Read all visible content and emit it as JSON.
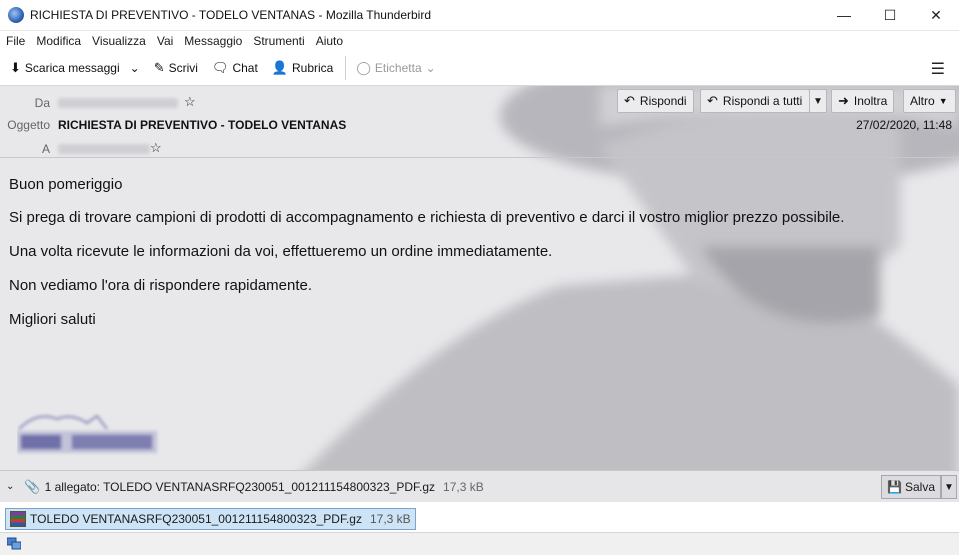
{
  "window": {
    "title": "RICHIESTA DI PREVENTIVO - TODELO VENTANAS - Mozilla Thunderbird"
  },
  "menu": [
    "File",
    "Modifica",
    "Visualizza",
    "Vai",
    "Messaggio",
    "Strumenti",
    "Aiuto"
  ],
  "toolbar": {
    "get_messages": "Scarica messaggi",
    "write": "Scrivi",
    "chat": "Chat",
    "address_book": "Rubrica",
    "tag": "Etichetta"
  },
  "header": {
    "from_label": "Da",
    "subject_label": "Oggetto",
    "to_label": "A",
    "subject": "RICHIESTA DI PREVENTIVO - TODELO VENTANAS",
    "date": "27/02/2020, 11:48",
    "reply": "Rispondi",
    "reply_all": "Rispondi a tutti",
    "forward": "Inoltra",
    "more": "Altro"
  },
  "body": {
    "greeting": "Buon pomeriggio",
    "line1": "Si prega di trovare campioni di prodotti di accompagnamento e richiesta di preventivo e darci il vostro miglior prezzo possibile.",
    "line2": "Una volta ricevute le informazioni da voi, effettueremo un ordine immediatamente.",
    "line3": "Non vediamo l'ora di rispondere rapidamente.",
    "closing": "Migliori saluti"
  },
  "attachments": {
    "summary": "1 allegato: TOLEDO VENTANASRFQ230051_001211154800323_PDF.gz",
    "summary_size": "17,3 kB",
    "save": "Salva",
    "item_name": "TOLEDO VENTANASRFQ230051_001211154800323_PDF.gz",
    "item_size": "17,3 kB"
  }
}
